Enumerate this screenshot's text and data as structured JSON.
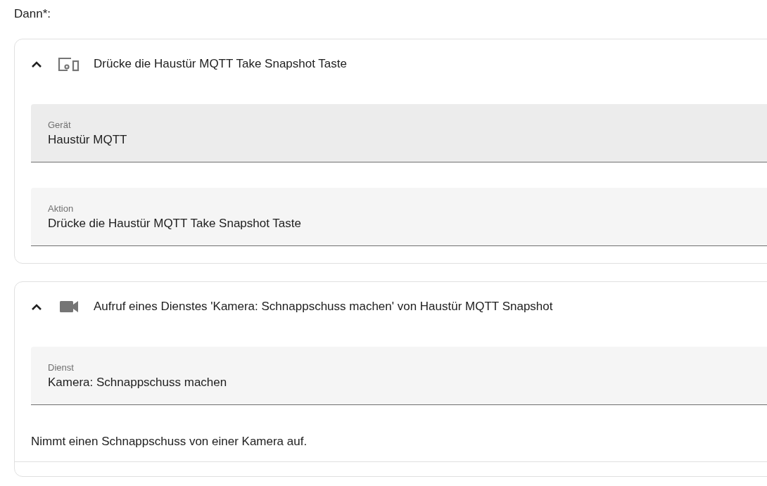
{
  "heading": "Dann*:",
  "cards": [
    {
      "kind": "device",
      "expanded": true,
      "title": "Drücke die Haustür MQTT Take Snapshot Taste",
      "fields": [
        {
          "label": "Gerät",
          "value": "Haustür MQTT",
          "highlighted": true
        },
        {
          "label": "Aktion",
          "value": "Drücke die Haustür MQTT Take Snapshot Taste",
          "highlighted": false
        }
      ]
    },
    {
      "kind": "service",
      "expanded": true,
      "title": "Aufruf eines Dienstes 'Kamera: Schnappschuss machen' von Haustür MQTT Snapshot",
      "fields": [
        {
          "label": "Dienst",
          "value": "Kamera: Schnappschuss machen",
          "highlighted": false
        }
      ],
      "description": "Nimmt einen Schnappschuss von einer Kamera auf."
    }
  ]
}
